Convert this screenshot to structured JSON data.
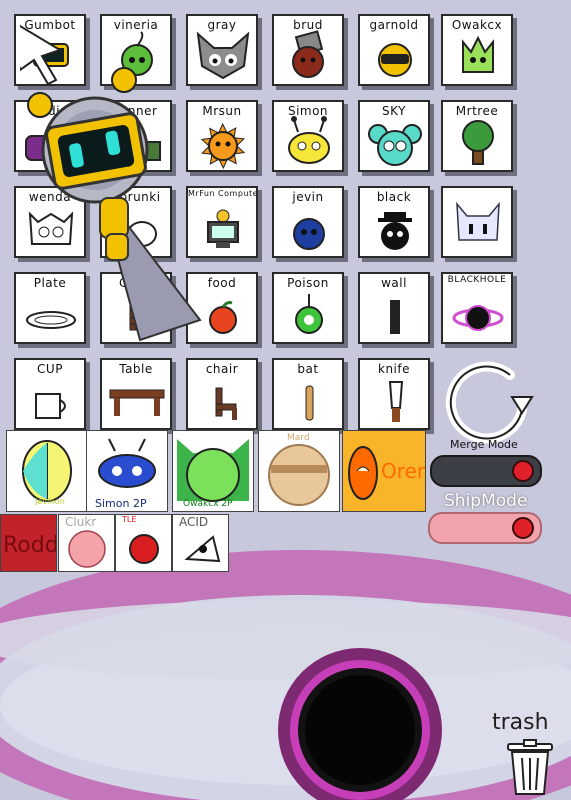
{
  "characters": [
    {
      "id": "gumbot",
      "label": "Gumbot",
      "color": "#f2c200"
    },
    {
      "id": "vineria",
      "label": "vineria",
      "color": "#5bbd3a"
    },
    {
      "id": "gray",
      "label": "gray",
      "color": "#8c8c8c"
    },
    {
      "id": "brud",
      "label": "brud",
      "color": "#8b2a1a"
    },
    {
      "id": "garnold",
      "label": "garnold",
      "color": "#f2c200"
    },
    {
      "id": "owakcx",
      "label": "Owakcx",
      "color": "#9be05b"
    },
    {
      "id": "oddie",
      "label": "oddie",
      "color": "#7a2d8a"
    },
    {
      "id": "tunner",
      "label": "tunner",
      "color": "#4a7a3a"
    },
    {
      "id": "mrsun",
      "label": "Mrsun",
      "color": "#f79a1b"
    },
    {
      "id": "simon",
      "label": "Simon",
      "color": "#f6e63a"
    },
    {
      "id": "sky",
      "label": "SKY",
      "color": "#59d9c8"
    },
    {
      "id": "mrtree",
      "label": "Mrtree",
      "color": "#3b9a3c"
    },
    {
      "id": "wenda",
      "label": "wenda",
      "color": "#ffffff"
    },
    {
      "id": "sprunki",
      "label": "Sprunki",
      "color": "#ff77aa"
    },
    {
      "id": "mrfuncomputer",
      "label": "MrFun Computer",
      "color": "#4a4a4a"
    },
    {
      "id": "jevin",
      "label": "jevin",
      "color": "#1e3fa0"
    },
    {
      "id": "black",
      "label": "black",
      "color": "#111111"
    },
    {
      "id": "clat",
      "label": "",
      "color": "#e6e8ff"
    },
    {
      "id": "plate",
      "label": "Plate",
      "color": "#ffffff"
    },
    {
      "id": "chair1",
      "label": "Chair",
      "color": "#6b3a22"
    },
    {
      "id": "food",
      "label": "food",
      "color": "#e8441f"
    },
    {
      "id": "poison",
      "label": "Poison",
      "color": "#3ec43a"
    },
    {
      "id": "wall",
      "label": "wall",
      "color": "#222222"
    },
    {
      "id": "blackhole",
      "label": "BLACKHOLE",
      "color": "#d04fd0"
    },
    {
      "id": "cup",
      "label": "CUP",
      "color": "#ffffff"
    },
    {
      "id": "table",
      "label": "Table",
      "color": "#7b3e22"
    },
    {
      "id": "chair2",
      "label": "chair",
      "color": "#6b3a22"
    },
    {
      "id": "bat",
      "label": "bat",
      "color": "#d8a25a"
    },
    {
      "id": "knife",
      "label": "knife",
      "color": "#8b4a22"
    }
  ],
  "merged": [
    {
      "id": "jevmon",
      "caption": "Jevmon",
      "bg": "#ffffff",
      "color": "#f5f575"
    },
    {
      "id": "simon2p",
      "caption": "Simon 2P",
      "bg": "#ffffff",
      "color": "#2a4dd0"
    },
    {
      "id": "owakcx2p",
      "caption": "Owakcx 2P",
      "bg": "#ffffff",
      "color": "#3cb44a"
    },
    {
      "id": "mard",
      "caption": "Mard",
      "bg": "#ffffff",
      "color": "#e8c79a"
    },
    {
      "id": "oren",
      "caption": "Oren",
      "bg": "#f9b52a",
      "color": "#ff6a00"
    }
  ],
  "ships": [
    {
      "id": "rodd",
      "caption": "Rodd",
      "bg": "#c1232a"
    },
    {
      "id": "clukr",
      "caption": "Clukr",
      "bg": "#ffffff"
    },
    {
      "id": "tle",
      "caption": "TLE",
      "bg": "#ffffff"
    },
    {
      "id": "acid",
      "caption": "ACID",
      "bg": "#ffffff"
    }
  ],
  "toggles": {
    "merge_label": "Merge Mode",
    "merge_on": true,
    "ship_label": "ShipMode",
    "ship_on": true
  },
  "actions": {
    "reset_icon": "circular-arrow-icon",
    "trash_label": "trash",
    "trash_icon": "trash-can-icon"
  },
  "colors": {
    "background": "#c7c8dc",
    "vortex": "#c267b4",
    "hole": "#0a0a0a",
    "toggle_dark": "#3c3f45",
    "toggle_light": "#f2a3ac",
    "knob": "#e0202b"
  }
}
